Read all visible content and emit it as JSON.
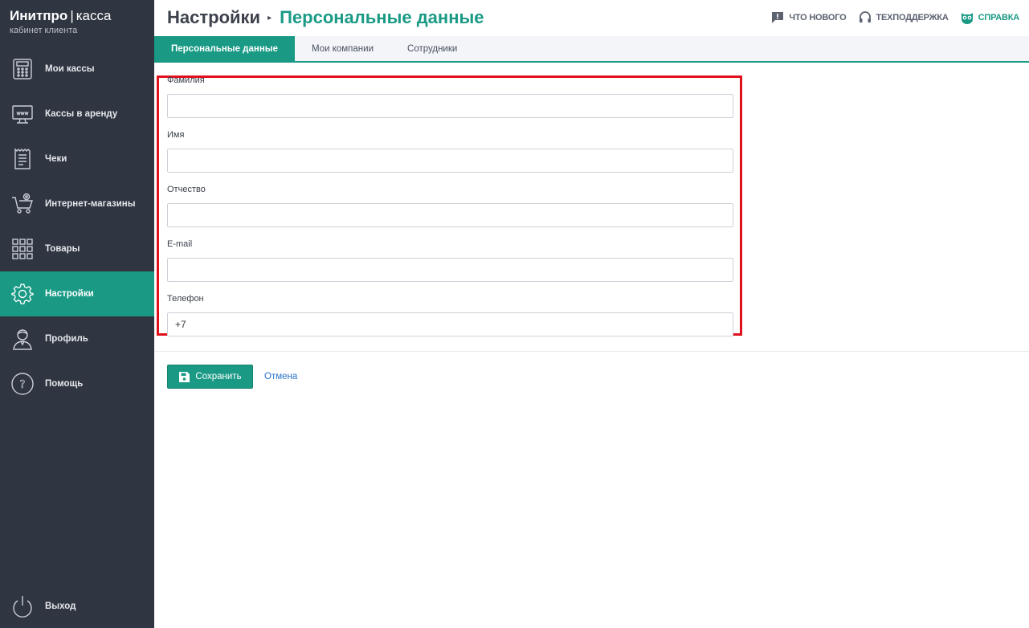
{
  "brand": {
    "name": "Инитпро",
    "separator": "|",
    "product": "касса",
    "subtitle": "кабинет клиента"
  },
  "sidebar": {
    "items": [
      {
        "label": "Мои кассы",
        "icon": "cash-register-icon"
      },
      {
        "label": "Кассы в аренду",
        "icon": "www-monitor-icon"
      },
      {
        "label": "Чеки",
        "icon": "receipt-icon"
      },
      {
        "label": "Интернет-магазины",
        "icon": "shopping-cart-at-icon"
      },
      {
        "label": "Товары",
        "icon": "grid-icon"
      },
      {
        "label": "Настройки",
        "icon": "gear-icon",
        "active": true
      },
      {
        "label": "Профиль",
        "icon": "user-icon"
      },
      {
        "label": "Помощь",
        "icon": "question-icon"
      }
    ],
    "logout": {
      "label": "Выход",
      "icon": "power-icon"
    }
  },
  "header": {
    "root": "Настройки",
    "arrow": "▸",
    "current": "Персональные данные",
    "actions": {
      "whats_new": "ЧТО НОВОГО",
      "support": "ТЕХПОДДЕРЖКА",
      "help": "СПРАВКА"
    }
  },
  "tabs": [
    {
      "label": "Персональные данные",
      "active": true
    },
    {
      "label": "Мои компании"
    },
    {
      "label": "Сотрудники"
    }
  ],
  "form": {
    "last_name": {
      "label": "Фамилия",
      "value": ""
    },
    "first_name": {
      "label": "Имя",
      "value": ""
    },
    "patronymic": {
      "label": "Отчество",
      "value": ""
    },
    "email": {
      "label": "E-mail",
      "value": ""
    },
    "phone": {
      "label": "Телефон",
      "value": "+7"
    }
  },
  "buttons": {
    "save": "Сохранить",
    "cancel": "Отмена"
  },
  "colors": {
    "accent": "#1a9a85",
    "sidebar_bg": "#2f3541",
    "highlight": "#e0101c",
    "link": "#2a72c9"
  }
}
